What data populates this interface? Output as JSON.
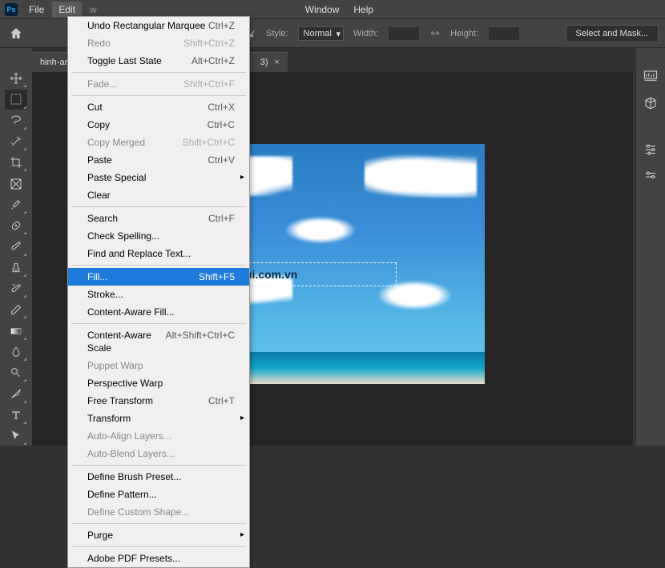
{
  "menubar": {
    "items": [
      "File",
      "Edit",
      "w",
      "Window",
      "Help"
    ]
  },
  "options": {
    "style_label": "Style:",
    "style_value": "Normal",
    "width_label": "Width:",
    "height_label": "Height:",
    "mask_label": "Select and Mask..."
  },
  "tab": {
    "name": "hinh-an",
    "mid": "3)",
    "close": "×"
  },
  "canvas": {
    "watermark": "dienthoaivui.com.vn"
  },
  "dropdown": [
    {
      "label": "Undo Rectangular Marquee",
      "shortcut": "Ctrl+Z",
      "disabled": false
    },
    {
      "label": "Redo",
      "shortcut": "Shift+Ctrl+Z",
      "disabled": true
    },
    {
      "label": "Toggle Last State",
      "shortcut": "Alt+Ctrl+Z",
      "disabled": false
    },
    {
      "sep": true
    },
    {
      "label": "Fade...",
      "shortcut": "Shift+Ctrl+F",
      "disabled": true
    },
    {
      "sep": true
    },
    {
      "label": "Cut",
      "shortcut": "Ctrl+X",
      "disabled": false
    },
    {
      "label": "Copy",
      "shortcut": "Ctrl+C",
      "disabled": false
    },
    {
      "label": "Copy Merged",
      "shortcut": "Shift+Ctrl+C",
      "disabled": true
    },
    {
      "label": "Paste",
      "shortcut": "Ctrl+V",
      "disabled": false
    },
    {
      "label": "Paste Special",
      "sub": true,
      "disabled": false
    },
    {
      "label": "Clear",
      "disabled": false
    },
    {
      "sep": true
    },
    {
      "label": "Search",
      "shortcut": "Ctrl+F",
      "disabled": false
    },
    {
      "label": "Check Spelling...",
      "disabled": false
    },
    {
      "label": "Find and Replace Text...",
      "disabled": false
    },
    {
      "sep": true
    },
    {
      "label": "Fill...",
      "shortcut": "Shift+F5",
      "highlighted": true,
      "disabled": false
    },
    {
      "label": "Stroke...",
      "disabled": false
    },
    {
      "label": "Content-Aware Fill...",
      "disabled": false
    },
    {
      "sep": true
    },
    {
      "label": "Content-Aware Scale",
      "shortcut": "Alt+Shift+Ctrl+C",
      "disabled": false
    },
    {
      "label": "Puppet Warp",
      "disabled": true
    },
    {
      "label": "Perspective Warp",
      "disabled": false
    },
    {
      "label": "Free Transform",
      "shortcut": "Ctrl+T",
      "disabled": false
    },
    {
      "label": "Transform",
      "sub": true,
      "disabled": false
    },
    {
      "label": "Auto-Align Layers...",
      "disabled": true
    },
    {
      "label": "Auto-Blend Layers...",
      "disabled": true
    },
    {
      "sep": true
    },
    {
      "label": "Define Brush Preset...",
      "disabled": false
    },
    {
      "label": "Define Pattern...",
      "disabled": false
    },
    {
      "label": "Define Custom Shape...",
      "disabled": true
    },
    {
      "sep": true
    },
    {
      "label": "Purge",
      "sub": true,
      "disabled": false
    },
    {
      "sep": true
    },
    {
      "label": "Adobe PDF Presets...",
      "disabled": false
    }
  ]
}
